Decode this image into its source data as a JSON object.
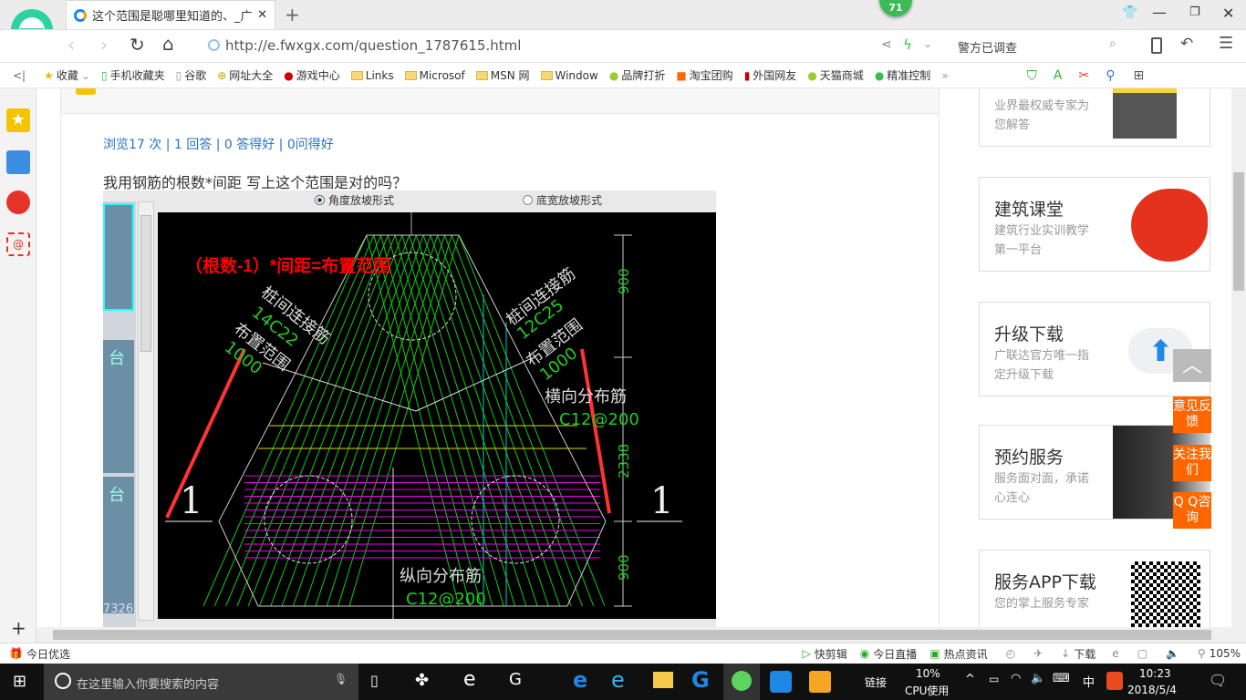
{
  "browser": {
    "badge": "71",
    "tab_title": "这个范围是聪哪里知道的、_广联",
    "url": "http://e.fwxgx.com/question_1787615.html",
    "search_hint": "警方已调查"
  },
  "bookmarks": [
    "收藏",
    "手机收藏夹",
    "谷歌",
    "网址大全",
    "游戏中心",
    "Links",
    "Microsof",
    "MSN 网",
    "Window",
    "品牌打折",
    "淘宝团购",
    "外国网友",
    "天猫商城",
    "精准控制"
  ],
  "question": {
    "stats": "浏览17 次 | 1 回答 | 0 答得好 | 0问得好",
    "body": "我用钢筋的根数*间距 写上这个范围是对的吗？"
  },
  "cad": {
    "radio1": "角度放坡形式",
    "radio2": "底宽放坡形式",
    "formula": "（根数-1）*间距=布置范围",
    "left_label1": "桩间连接筋",
    "left_label2": "14C22",
    "left_label3": "布置范围",
    "left_label4": "1000",
    "right_label1": "桩间连接筋",
    "right_label2": "12C25",
    "right_label3": "布置范围",
    "right_label4": "1000",
    "trans_label": "横向分布筋",
    "trans_spec": "C12@200",
    "long_label": "纵向分布筋",
    "long_spec": "C12@200",
    "dims": [
      "900",
      "2338",
      "900"
    ],
    "section_mark": "1",
    "thumb_text": [
      "台",
      "台",
      "7326"
    ]
  },
  "sidebar_cards": [
    {
      "title": "",
      "sub": "业界最权威专家为您解答"
    },
    {
      "title": "建筑课堂",
      "sub": "建筑行业实训教学第一平台"
    },
    {
      "title": "升级下载",
      "sub": "广联达官方唯一指定升级下载"
    },
    {
      "title": "预约服务",
      "sub": "服务面对面，承诺心连心"
    },
    {
      "title": "服务APP下载",
      "sub": "您的掌上服务专家"
    }
  ],
  "float_buttons": [
    "意见反馈",
    "关注我们",
    "Q Q咨询"
  ],
  "statusbar": {
    "left": "今日优选",
    "items": [
      "快剪辑",
      "今日直播",
      "热点资讯",
      "下载"
    ],
    "zoom": "105%"
  },
  "taskbar": {
    "search_placeholder": "在这里输入你要搜索的内容",
    "link": "链接",
    "cpu": "10%",
    "cpu_label": "CPU使用",
    "ime": "中",
    "time": "10:23",
    "date": "2018/5/4"
  }
}
